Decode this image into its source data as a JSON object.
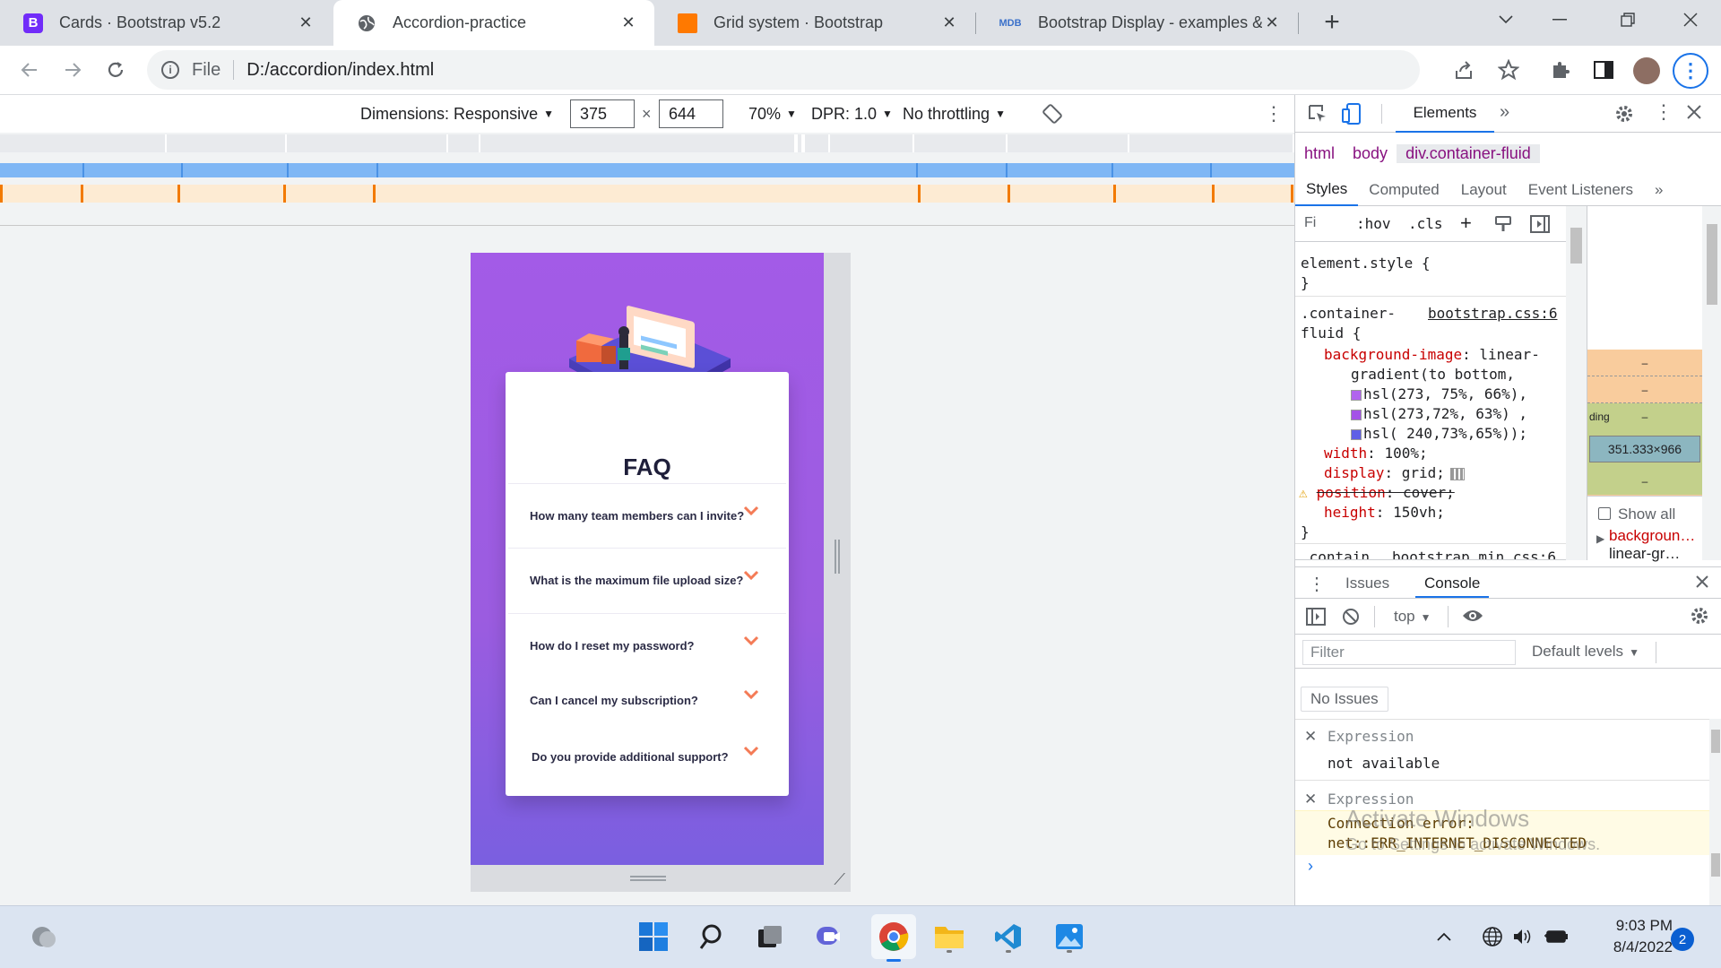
{
  "browser": {
    "tabs": [
      {
        "title": "Cards · Bootstrap v5.2",
        "favicon": "bootstrap-icon",
        "close": "✕"
      },
      {
        "title": "Accordion-practice",
        "favicon": "globe-icon",
        "close": "✕"
      },
      {
        "title": "Grid system · Bootstrap",
        "favicon": "orange-icon",
        "close": "✕"
      },
      {
        "title": "Bootstrap Display - examples & t",
        "favicon": "mdb-icon",
        "close": "✕"
      }
    ],
    "new_tab": "+",
    "fav_b": "B",
    "fav_mdb": "MDB",
    "address": {
      "scheme_label": "File",
      "url": "D:/accordion/index.html"
    }
  },
  "device_toolbar": {
    "dimensions_label": "Dimensions: Responsive",
    "width": "375",
    "times": "×",
    "height": "644",
    "zoom": "70%",
    "dpr": "DPR: 1.0",
    "throttling": "No throttling"
  },
  "page": {
    "faq_title": "FAQ",
    "questions": [
      "How many team members can I invite?",
      "What is the maximum file upload size?",
      "How do I reset my password?",
      "Can I cancel my subscription?",
      "Do you provide additional support?"
    ],
    "accent_color": "#f47b56"
  },
  "devtools": {
    "tabs": {
      "elements": "Elements",
      "more": "»"
    },
    "breadcrumbs": [
      "html",
      "body",
      "div.container-fluid"
    ],
    "style_tabs": [
      "Styles",
      "Computed",
      "Layout",
      "Event Listeners",
      "»"
    ],
    "filter_placeholder": "Fi",
    "hov": ":hov",
    "cls": ".cls",
    "css": {
      "element_style_open": "element.style {",
      "close_brace": "}",
      "sel1a": ".container-",
      "sel1b": "fluid {",
      "source1": "bootstrap.css:6",
      "bg_prop": "background-image",
      "bg_val1": "linear-",
      "bg_val2": "gradient(to bottom,",
      "color1": "hsl(273, 75%, 66%),",
      "color2": "hsl(273,72%, 63%) ,",
      "color3": "hsl( 240,73%,65%));",
      "width_prop": "width",
      "width_val": "100%;",
      "display_prop": "display",
      "display_val": "grid;",
      "position_prop": "position",
      "position_val": "cover;",
      "height_prop": "height",
      "height_val": "150vh;",
      "sel2": ".contain",
      "source2": "bootstrap.min.css:6",
      "sel2_trail": "container-fluid"
    },
    "boxmodel": {
      "padding_label": "ding",
      "dash": "–",
      "content_size": "351.333×966",
      "show_all": "Show all",
      "computed1": "backgroun…",
      "computed2": "linear-gr…"
    },
    "drawer_tabs": [
      "Issues",
      "Console"
    ],
    "context": "top",
    "filter": "Filter",
    "levels": "Default levels",
    "no_issues": "No Issues",
    "expressions": [
      {
        "label": "Expression",
        "value": "not available"
      },
      {
        "label": "Expression",
        "value1": "Connection error:",
        "value2": "net::ERR_INTERNET_DISCONNECTED"
      }
    ],
    "prompt": "›",
    "watermark_1": "Activate Windows",
    "watermark_2": "Go to Settings to activate Windows."
  },
  "taskbar": {
    "time": "9:03 PM",
    "date": "8/4/2022",
    "notifications": "2"
  }
}
